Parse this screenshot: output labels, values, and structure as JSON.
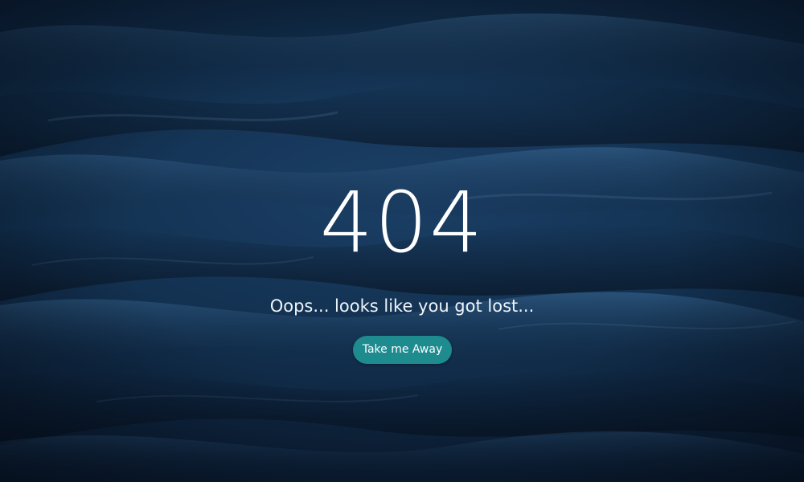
{
  "error_page": {
    "code": "404",
    "message": "Oops... looks like you got lost...",
    "button_label": "Take me Away"
  },
  "background": {
    "description_icon": "ocean-waves-image"
  },
  "colors": {
    "button": "#1e8b8f",
    "text": "#ffffff",
    "background_dark": "#0a1a2f",
    "background_mid": "#1b3f66"
  }
}
